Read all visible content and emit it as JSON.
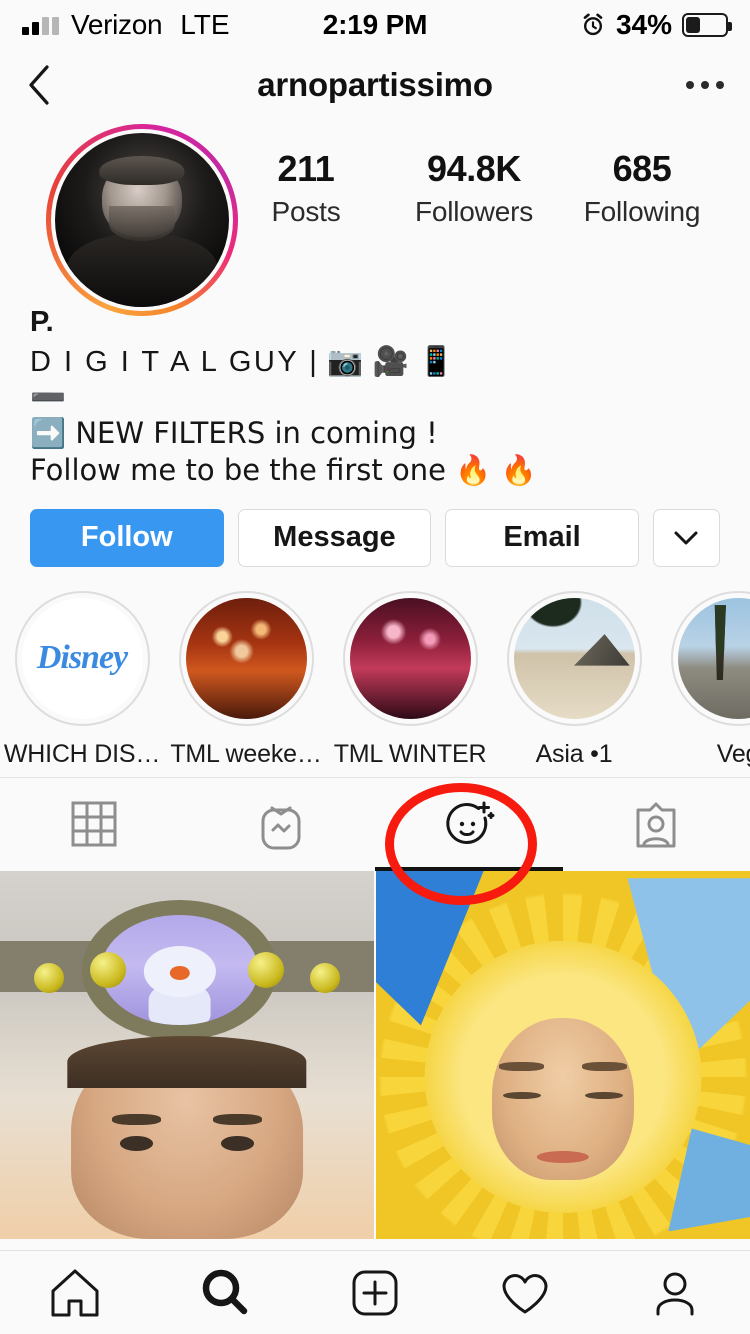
{
  "status_bar": {
    "carrier": "Verizon",
    "network": "LTE",
    "time": "2:19 PM",
    "battery_percent": "34%",
    "alarm_icon": "alarm-icon",
    "signal_icon": "signal-bars-icon",
    "battery_icon": "battery-icon"
  },
  "nav": {
    "back_icon": "back-chevron-icon",
    "title": "arnopartissimo",
    "more_icon": "more-options-icon"
  },
  "profile": {
    "avatar_label": "arnopartissimo profile photo",
    "has_story_ring": true,
    "stats": [
      {
        "value": "211",
        "label": "Posts"
      },
      {
        "value": "94.8K",
        "label": "Followers"
      },
      {
        "value": "685",
        "label": "Following"
      }
    ],
    "bio": {
      "name": "P.",
      "line1": "D I G I T A L GUY |",
      "line1_emojis": "📷 🎥 📱",
      "divider": "➖",
      "line2": "➡️  NEW FILTERS in coming !",
      "line3": "Follow me to be the first one 🔥 🔥"
    }
  },
  "actions": {
    "follow_label": "Follow",
    "message_label": "Message",
    "email_label": "Email",
    "caret_icon": "chevron-down-icon",
    "follow_color": "#3897f0"
  },
  "highlights": [
    {
      "label": "WHICH DIS…",
      "art": "disney",
      "art_text": "Disney"
    },
    {
      "label": "TML weeke…",
      "art": "fw1",
      "art_text": ""
    },
    {
      "label": "TML WINTER",
      "art": "fw2",
      "art_text": ""
    },
    {
      "label": "Asia •1",
      "art": "beach",
      "art_text": ""
    },
    {
      "label": "Veg",
      "art": "vegas",
      "art_text": ""
    }
  ],
  "tabs": [
    {
      "name": "grid",
      "icon": "grid-icon",
      "active": false
    },
    {
      "name": "igtv",
      "icon": "igtv-icon",
      "active": false
    },
    {
      "name": "effects",
      "icon": "effects-face-icon",
      "active": true
    },
    {
      "name": "tagged",
      "icon": "tagged-person-icon",
      "active": false
    }
  ],
  "annotation": {
    "shape": "circle",
    "color": "#f71a0f",
    "target": "effects-tab"
  },
  "grid_posts": [
    {
      "name": "frozen-olaf-headband-filter"
    },
    {
      "name": "sunshine-face-filter"
    }
  ],
  "bottom_nav": [
    {
      "icon": "home-icon",
      "active": false
    },
    {
      "icon": "search-icon",
      "active": true
    },
    {
      "icon": "add-post-icon",
      "active": false
    },
    {
      "icon": "activity-heart-icon",
      "active": false
    },
    {
      "icon": "profile-person-icon",
      "active": false
    }
  ]
}
